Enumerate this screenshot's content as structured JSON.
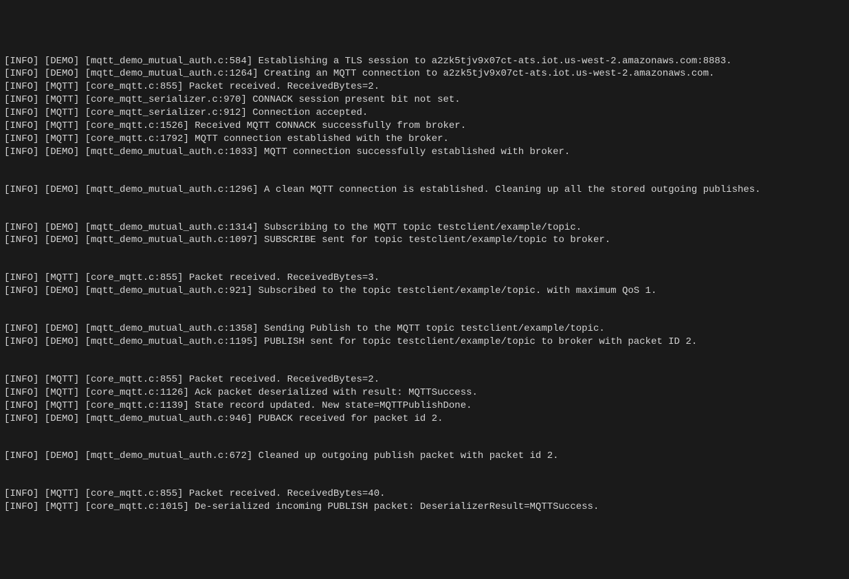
{
  "lines": [
    "[INFO] [DEMO] [mqtt_demo_mutual_auth.c:584] Establishing a TLS session to a2zk5tjv9x07ct-ats.iot.us-west-2.amazonaws.com:8883.",
    "[INFO] [DEMO] [mqtt_demo_mutual_auth.c:1264] Creating an MQTT connection to a2zk5tjv9x07ct-ats.iot.us-west-2.amazonaws.com.",
    "[INFO] [MQTT] [core_mqtt.c:855] Packet received. ReceivedBytes=2.",
    "[INFO] [MQTT] [core_mqtt_serializer.c:970] CONNACK session present bit not set.",
    "[INFO] [MQTT] [core_mqtt_serializer.c:912] Connection accepted.",
    "[INFO] [MQTT] [core_mqtt.c:1526] Received MQTT CONNACK successfully from broker.",
    "[INFO] [MQTT] [core_mqtt.c:1792] MQTT connection established with the broker.",
    "[INFO] [DEMO] [mqtt_demo_mutual_auth.c:1033] MQTT connection successfully established with broker.",
    "",
    "",
    "[INFO] [DEMO] [mqtt_demo_mutual_auth.c:1296] A clean MQTT connection is established. Cleaning up all the stored outgoing publishes.",
    "",
    "",
    "[INFO] [DEMO] [mqtt_demo_mutual_auth.c:1314] Subscribing to the MQTT topic testclient/example/topic.",
    "[INFO] [DEMO] [mqtt_demo_mutual_auth.c:1097] SUBSCRIBE sent for topic testclient/example/topic to broker.",
    "",
    "",
    "[INFO] [MQTT] [core_mqtt.c:855] Packet received. ReceivedBytes=3.",
    "[INFO] [DEMO] [mqtt_demo_mutual_auth.c:921] Subscribed to the topic testclient/example/topic. with maximum QoS 1.",
    "",
    "",
    "[INFO] [DEMO] [mqtt_demo_mutual_auth.c:1358] Sending Publish to the MQTT topic testclient/example/topic.",
    "[INFO] [DEMO] [mqtt_demo_mutual_auth.c:1195] PUBLISH sent for topic testclient/example/topic to broker with packet ID 2.",
    "",
    "",
    "[INFO] [MQTT] [core_mqtt.c:855] Packet received. ReceivedBytes=2.",
    "[INFO] [MQTT] [core_mqtt.c:1126] Ack packet deserialized with result: MQTTSuccess.",
    "[INFO] [MQTT] [core_mqtt.c:1139] State record updated. New state=MQTTPublishDone.",
    "[INFO] [DEMO] [mqtt_demo_mutual_auth.c:946] PUBACK received for packet id 2.",
    "",
    "",
    "[INFO] [DEMO] [mqtt_demo_mutual_auth.c:672] Cleaned up outgoing publish packet with packet id 2.",
    "",
    "",
    "[INFO] [MQTT] [core_mqtt.c:855] Packet received. ReceivedBytes=40.",
    "[INFO] [MQTT] [core_mqtt.c:1015] De-serialized incoming PUBLISH packet: DeserializerResult=MQTTSuccess."
  ]
}
